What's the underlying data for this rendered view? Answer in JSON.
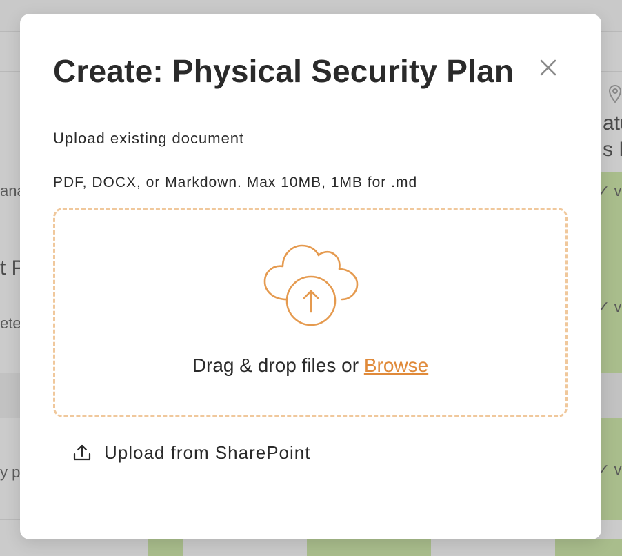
{
  "background": {
    "fragments": [
      "ana",
      "t P",
      "ete",
      "y p",
      "atu",
      "s P",
      "✓ v",
      "✓ v",
      "✓ v"
    ]
  },
  "modal": {
    "title": "Create: Physical Security Plan",
    "close_icon": "close-icon",
    "upload_label": "Upload existing document",
    "upload_hint": "PDF, DOCX, or Markdown. Max 10MB, 1MB for .md",
    "dropzone": {
      "icon": "cloud-upload-icon",
      "text": "Drag & drop files or ",
      "browse_label": "Browse"
    },
    "sharepoint": {
      "icon": "upload-icon",
      "label": "Upload from SharePoint"
    }
  },
  "colors": {
    "accent": "#e08a3a",
    "dropzone_border": "#f0c89c",
    "text": "#2a2a2a",
    "success_bg": "#a9bd8c"
  }
}
